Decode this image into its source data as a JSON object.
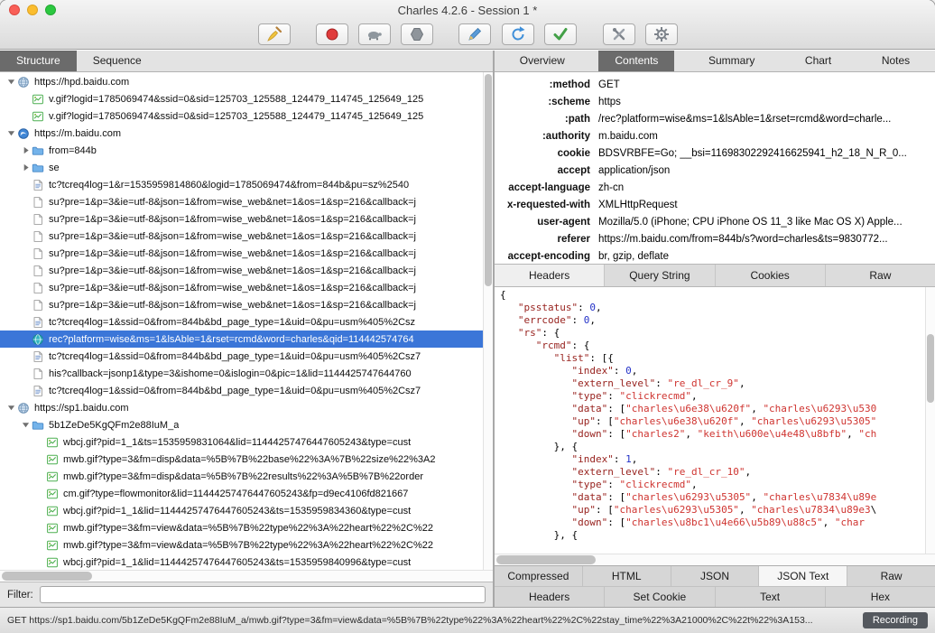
{
  "window": {
    "title": "Charles 4.2.6 - Session 1 *"
  },
  "toolbar": {
    "buttons": [
      {
        "id": "clear-session",
        "icon": "broom"
      },
      {
        "id": "record",
        "icon": "record"
      },
      {
        "id": "throttle",
        "icon": "turtle"
      },
      {
        "id": "breakpoints",
        "icon": "hexagon"
      },
      {
        "id": "compose",
        "icon": "pencil"
      },
      {
        "id": "repeat",
        "icon": "refresh"
      },
      {
        "id": "validate",
        "icon": "check"
      },
      {
        "id": "tools",
        "icon": "tools"
      },
      {
        "id": "settings",
        "icon": "gear"
      }
    ]
  },
  "left_panel": {
    "tabs": [
      {
        "label": "Structure",
        "active": true
      },
      {
        "label": "Sequence",
        "active": false
      }
    ],
    "tree": [
      {
        "text": "https://hpd.baidu.com",
        "icon": "globe",
        "level": 0,
        "disclosure": "open"
      },
      {
        "text": "v.gif?logid=1785069474&ssid=0&sid=125703_125588_124479_114745_125649_125",
        "icon": "gif",
        "level": 1
      },
      {
        "text": "v.gif?logid=1785069474&ssid=0&sid=125703_125588_124479_114745_125649_125",
        "icon": "gif",
        "level": 1
      },
      {
        "text": "https://m.baidu.com",
        "icon": "globe-blue",
        "level": 0,
        "disclosure": "open"
      },
      {
        "text": "from=844b",
        "icon": "folder",
        "level": 1,
        "disclosure": "closed"
      },
      {
        "text": "se",
        "icon": "folder",
        "level": 1,
        "disclosure": "closed"
      },
      {
        "text": "tc?tcreq4log=1&r=1535959814860&logid=1785069474&from=844b&pu=sz%2540",
        "icon": "doc",
        "level": 1
      },
      {
        "text": "su?pre=1&p=3&ie=utf-8&json=1&from=wise_web&net=1&os=1&sp=216&callback=j",
        "icon": "doc-plain",
        "level": 1
      },
      {
        "text": "su?pre=1&p=3&ie=utf-8&json=1&from=wise_web&net=1&os=1&sp=216&callback=j",
        "icon": "doc-plain",
        "level": 1
      },
      {
        "text": "su?pre=1&p=3&ie=utf-8&json=1&from=wise_web&net=1&os=1&sp=216&callback=j",
        "icon": "doc-plain",
        "level": 1
      },
      {
        "text": "su?pre=1&p=3&ie=utf-8&json=1&from=wise_web&net=1&os=1&sp=216&callback=j",
        "icon": "doc-plain",
        "level": 1
      },
      {
        "text": "su?pre=1&p=3&ie=utf-8&json=1&from=wise_web&net=1&os=1&sp=216&callback=j",
        "icon": "doc-plain",
        "level": 1
      },
      {
        "text": "su?pre=1&p=3&ie=utf-8&json=1&from=wise_web&net=1&os=1&sp=216&callback=j",
        "icon": "doc-plain",
        "level": 1
      },
      {
        "text": "su?pre=1&p=3&ie=utf-8&json=1&from=wise_web&net=1&os=1&sp=216&callback=j",
        "icon": "doc-plain",
        "level": 1
      },
      {
        "text": "tc?tcreq4log=1&ssid=0&from=844b&bd_page_type=1&uid=0&pu=usm%405%2Csz",
        "icon": "doc",
        "level": 1
      },
      {
        "text": "rec?platform=wise&ms=1&lsAble=1&rset=rcmd&word=charles&qid=114442574764",
        "icon": "rec",
        "level": 1,
        "selected": true
      },
      {
        "text": "tc?tcreq4log=1&ssid=0&from=844b&bd_page_type=1&uid=0&pu=usm%405%2Csz7",
        "icon": "doc",
        "level": 1
      },
      {
        "text": "his?callback=jsonp1&type=3&ishome=0&islogin=0&pic=1&lid=1144425747644760",
        "icon": "doc-plain",
        "level": 1
      },
      {
        "text": "tc?tcreq4log=1&ssid=0&from=844b&bd_page_type=1&uid=0&pu=usm%405%2Csz7",
        "icon": "doc",
        "level": 1
      },
      {
        "text": "https://sp1.baidu.com",
        "icon": "globe",
        "level": 0,
        "disclosure": "open"
      },
      {
        "text": "5b1ZeDe5KgQFm2e88IuM_a",
        "icon": "folder",
        "level": 1,
        "disclosure": "open"
      },
      {
        "text": "wbcj.gif?pid=1_1&ts=1535959831064&lid=11444257476447605243&type=cust",
        "icon": "gif",
        "level": 2
      },
      {
        "text": "mwb.gif?type=3&fm=disp&data=%5B%7B%22base%22%3A%7B%22size%22%3A2",
        "icon": "gif",
        "level": 2
      },
      {
        "text": "mwb.gif?type=3&fm=disp&data=%5B%7B%22results%22%3A%5B%7B%22order",
        "icon": "gif",
        "level": 2
      },
      {
        "text": "cm.gif?type=flowmonitor&lid=11444257476447605243&fp=d9ec4106fd821667",
        "icon": "gif",
        "level": 2
      },
      {
        "text": "wbcj.gif?pid=1_1&lid=11444257476447605243&ts=1535959834360&type=cust",
        "icon": "gif",
        "level": 2
      },
      {
        "text": "mwb.gif?type=3&fm=view&data=%5B%7B%22type%22%3A%22heart%22%2C%22",
        "icon": "gif",
        "level": 2
      },
      {
        "text": "mwb.gif?type=3&fm=view&data=%5B%7B%22type%22%3A%22heart%22%2C%22",
        "icon": "gif",
        "level": 2
      },
      {
        "text": "wbcj.gif?pid=1_1&lid=11444257476447605243&ts=1535959840996&type=cust",
        "icon": "gif",
        "level": 2
      }
    ],
    "filter": {
      "label": "Filter:",
      "value": ""
    }
  },
  "right_panel": {
    "tabs": [
      {
        "label": "Overview",
        "active": false
      },
      {
        "label": "Contents",
        "active": true
      },
      {
        "label": "Summary",
        "active": false
      },
      {
        "label": "Chart",
        "active": false
      },
      {
        "label": "Notes",
        "active": false
      }
    ],
    "request_headers": [
      {
        "name": ":method",
        "value": "GET"
      },
      {
        "name": ":scheme",
        "value": "https"
      },
      {
        "name": ":path",
        "value": "/rec?platform=wise&ms=1&lsAble=1&rset=rcmd&word=charle..."
      },
      {
        "name": ":authority",
        "value": "m.baidu.com"
      },
      {
        "name": "cookie",
        "value": "BDSVRBFE=Go; __bsi=11698302292416625941_h2_18_N_R_0..."
      },
      {
        "name": "accept",
        "value": "application/json"
      },
      {
        "name": "accept-language",
        "value": "zh-cn"
      },
      {
        "name": "x-requested-with",
        "value": "XMLHttpRequest"
      },
      {
        "name": "user-agent",
        "value": "Mozilla/5.0 (iPhone; CPU iPhone OS 11_3 like Mac OS X) Apple..."
      },
      {
        "name": "referer",
        "value": "https://m.baidu.com/from=844b/s?word=charles&ts=9830772..."
      },
      {
        "name": "accept-encoding",
        "value": "br, gzip, deflate"
      }
    ],
    "request_view_tabs": [
      {
        "label": "Headers",
        "active": true
      },
      {
        "label": "Query String",
        "active": false
      },
      {
        "label": "Cookies",
        "active": false
      },
      {
        "label": "Raw",
        "active": false
      }
    ],
    "response_body_lines": [
      "{",
      "   \"psstatus\": 0,",
      "   \"errcode\": 0,",
      "   \"rs\": {",
      "      \"rcmd\": {",
      "         \"list\": [{",
      "            \"index\": 0,",
      "            \"extern_level\": \"re_dl_cr_9\",",
      "            \"type\": \"clickrecmd\",",
      "            \"data\": [\"charles\\u6e38\\u620f\", \"charles\\u6293\\u530",
      "            \"up\": [\"charles\\u6e38\\u620f\", \"charles\\u6293\\u5305\"",
      "            \"down\": [\"charles2\", \"keith\\u600e\\u4e48\\u8bfb\", \"ch",
      "         }, {",
      "            \"index\": 1,",
      "            \"extern_level\": \"re_dl_cr_10\",",
      "            \"type\": \"clickrecmd\",",
      "            \"data\": [\"charles\\u6293\\u5305\", \"charles\\u7834\\u89e",
      "            \"up\": [\"charles\\u6293\\u5305\", \"charles\\u7834\\u89e3\\",
      "            \"down\": [\"charles\\u8bc1\\u4e66\\u5b89\\u88c5\", \"char",
      "         }, {"
    ],
    "response_view_tabs_row1": [
      {
        "label": "Compressed",
        "active": false
      },
      {
        "label": "HTML",
        "active": false
      },
      {
        "label": "JSON",
        "active": false
      },
      {
        "label": "JSON Text",
        "active": true
      },
      {
        "label": "Raw",
        "active": false
      }
    ],
    "response_view_tabs_row2": [
      {
        "label": "Headers",
        "active": false
      },
      {
        "label": "Set Cookie",
        "active": false
      },
      {
        "label": "Text",
        "active": false
      },
      {
        "label": "Hex",
        "active": false
      }
    ]
  },
  "status_bar": {
    "text": "GET https://sp1.baidu.com/5b1ZeDe5KgQFm2e88IuM_a/mwb.gif?type=3&fm=view&data=%5B%7B%22type%22%3A%22heart%22%2C%22stay_time%22%3A21000%2C%22t%22%3A153...",
    "recording_label": "Recording"
  }
}
